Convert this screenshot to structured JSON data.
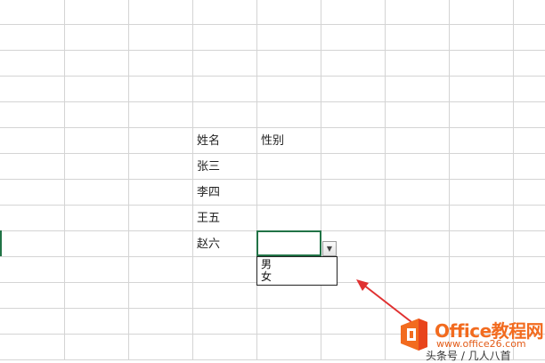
{
  "sheet": {
    "header_row": {
      "name_col": "姓名",
      "gender_col": "性别"
    },
    "names": [
      "张三",
      "李四",
      "王五",
      "赵六"
    ]
  },
  "dropdown": {
    "options": [
      "男",
      "女"
    ]
  },
  "watermark": {
    "title": "Office教程网",
    "url": "www.office26.com",
    "author": "头条号 / 几人八首"
  },
  "colors": {
    "gridline": "#d4d4d4",
    "selection_border": "#217346",
    "arrow": "#e03131",
    "logo_orange": "#f26b1f",
    "logo_red": "#e8441c"
  },
  "icons": {
    "dropdown_button": "triangle-down",
    "logo": "office-logo"
  }
}
